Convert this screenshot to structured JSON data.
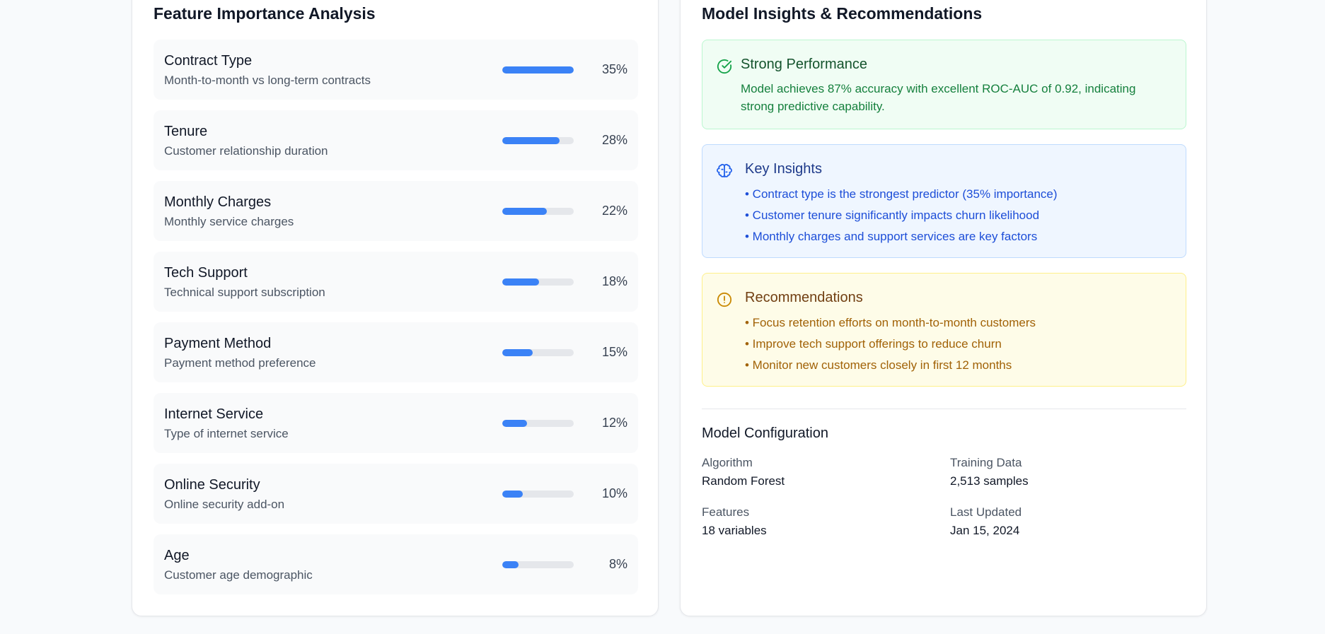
{
  "feature_panel": {
    "title": "Feature Importance Analysis",
    "features": [
      {
        "name": "Contract Type",
        "description": "Month-to-month vs long-term contracts",
        "importance": 35,
        "label": "35%"
      },
      {
        "name": "Tenure",
        "description": "Customer relationship duration",
        "importance": 28,
        "label": "28%"
      },
      {
        "name": "Monthly Charges",
        "description": "Monthly service charges",
        "importance": 22,
        "label": "22%"
      },
      {
        "name": "Tech Support",
        "description": "Technical support subscription",
        "importance": 18,
        "label": "18%"
      },
      {
        "name": "Payment Method",
        "description": "Payment method preference",
        "importance": 15,
        "label": "15%"
      },
      {
        "name": "Internet Service",
        "description": "Type of internet service",
        "importance": 12,
        "label": "12%"
      },
      {
        "name": "Online Security",
        "description": "Online security add-on",
        "importance": 10,
        "label": "10%"
      },
      {
        "name": "Age",
        "description": "Customer age demographic",
        "importance": 8,
        "label": "8%"
      }
    ],
    "bar_max_importance": 35,
    "bar_color": "#3b82f6"
  },
  "insights_panel": {
    "title": "Model Insights & Recommendations",
    "performance": {
      "heading": "Strong Performance",
      "body": "Model achieves 87% accuracy with excellent ROC-AUC of 0.92, indicating strong predictive capability.",
      "icon": "check-circle-icon",
      "color": "#16a34a"
    },
    "key_insights": {
      "heading": "Key Insights",
      "items": [
        "• Contract type is the strongest predictor (35% importance)",
        "• Customer tenure significantly impacts churn likelihood",
        "• Monthly charges and support services are key factors"
      ],
      "icon": "brain-icon",
      "color": "#2563eb"
    },
    "recommendations": {
      "heading": "Recommendations",
      "items": [
        "• Focus retention efforts on month-to-month customers",
        "• Improve tech support offerings to reduce churn",
        "• Monitor new customers closely in first 12 months"
      ],
      "icon": "alert-circle-icon",
      "color": "#ca8a04"
    },
    "configuration": {
      "title": "Model Configuration",
      "algorithm_label": "Algorithm",
      "algorithm_value": "Random Forest",
      "training_label": "Training Data",
      "training_value": "2,513 samples",
      "features_label": "Features",
      "features_value": "18 variables",
      "updated_label": "Last Updated",
      "updated_value": "Jan 15, 2024"
    }
  }
}
